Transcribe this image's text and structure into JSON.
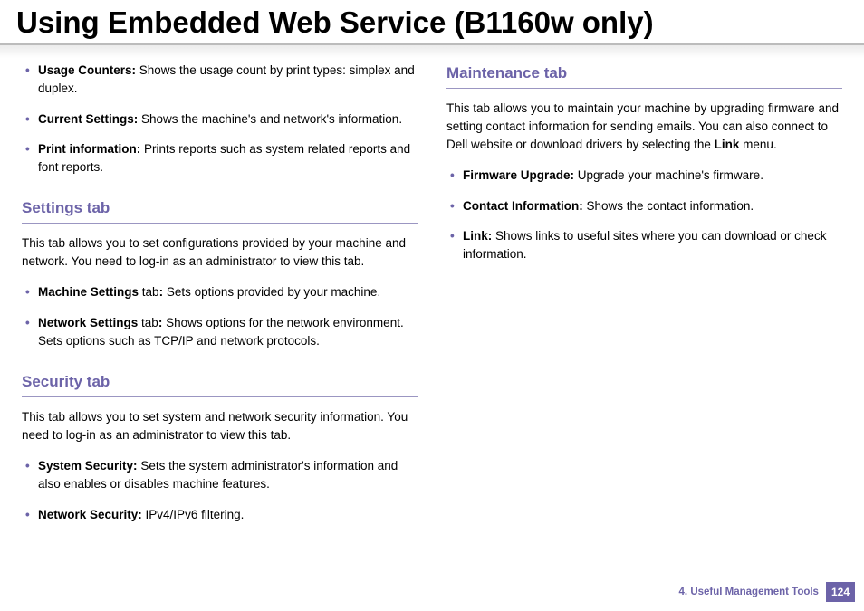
{
  "title": "Using Embedded Web Service (B1160w only)",
  "leftColumn": {
    "topList": [
      {
        "term": "Usage Counters:",
        "desc": " Shows the usage count by print types: simplex and duplex."
      },
      {
        "term": "Current Settings:",
        "desc": " Shows the machine's and network's information."
      },
      {
        "term": "Print information:",
        "desc": " Prints reports such as system related reports and font reports."
      }
    ],
    "settings": {
      "heading": "Settings tab",
      "intro": "This tab allows you to set configurations provided by your machine and network. You need to log-in as an administrator to view this tab.",
      "items": [
        {
          "term": "Machine Settings",
          "mid": " tab",
          "colon": ":",
          "desc": " Sets options provided by your machine."
        },
        {
          "term": "Network Settings",
          "mid": " tab",
          "colon": ":",
          "desc": " Shows options for the network environment. Sets options such as TCP/IP and network protocols."
        }
      ]
    },
    "security": {
      "heading": "Security tab",
      "intro": "This tab allows you to set system and network security information. You need to log-in as an administrator to view this tab.",
      "items": [
        {
          "term": "System Security:",
          "desc": " Sets the system administrator's information and also enables or disables machine features."
        },
        {
          "term": "Network Security:",
          "desc": "  IPv4/IPv6 filtering."
        }
      ]
    }
  },
  "rightColumn": {
    "maintenance": {
      "heading": "Maintenance tab",
      "introPre": "This tab allows you to maintain your machine by upgrading firmware and setting contact information for sending emails. You can also connect to Dell website or download drivers by selecting the ",
      "introBold": "Link",
      "introPost": " menu.",
      "items": [
        {
          "term": "Firmware Upgrade:",
          "desc": " Upgrade your machine's firmware."
        },
        {
          "term": "Contact Information:",
          "desc": " Shows the contact information."
        },
        {
          "term": "Link:",
          "desc": " Shows links to useful sites where you can download or check information."
        }
      ]
    }
  },
  "footer": {
    "chapter": "4.  Useful Management Tools",
    "page": "124"
  }
}
